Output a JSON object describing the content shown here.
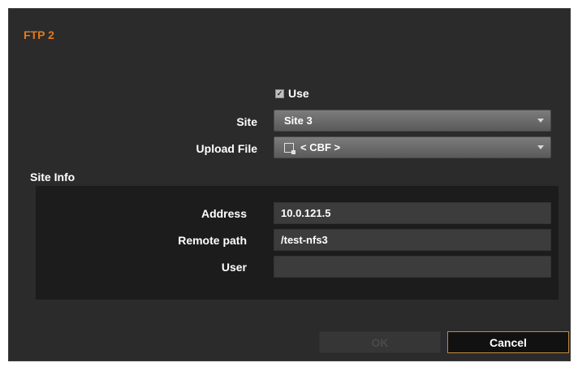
{
  "dialog": {
    "title": "FTP 2",
    "use_label": "Use",
    "use_checked": true,
    "site_label": "Site",
    "site_value": "Site 3",
    "upload_file_label": "Upload File",
    "upload_file_value": "< CBF >",
    "site_info_label": "Site Info",
    "site_info": {
      "address_label": "Address",
      "address_value": "10.0.121.5",
      "remote_path_label": "Remote path",
      "remote_path_value": "/test-nfs3",
      "user_label": "User",
      "user_value": ""
    },
    "ok_label": "OK",
    "cancel_label": "Cancel"
  },
  "colors": {
    "title": "#e07a1f",
    "background": "#2b2b2b",
    "panel": "#1c1c1c",
    "cancel_border": "#c08a3e"
  },
  "icons": {
    "checkbox": "check-icon",
    "dropdown": "chevron-down-icon",
    "file": "file-icon"
  }
}
